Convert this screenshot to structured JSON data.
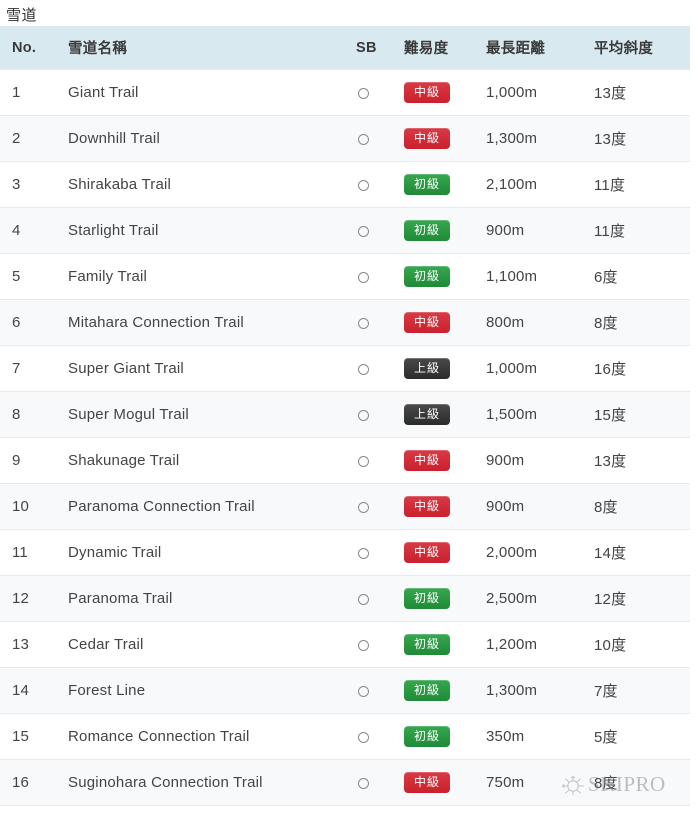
{
  "page": {
    "title": "雪道"
  },
  "table": {
    "columns": [
      {
        "key": "no",
        "label": "No."
      },
      {
        "key": "name",
        "label": "雪道名稱"
      },
      {
        "key": "sb",
        "label": "SB"
      },
      {
        "key": "diff",
        "label": "難易度"
      },
      {
        "key": "dist",
        "label": "最長距離"
      },
      {
        "key": "slope",
        "label": "平均斜度"
      }
    ],
    "sb_symbol": "○",
    "rows": [
      {
        "no": "1",
        "name": "Giant Trail",
        "sb": "○",
        "diff": "中級",
        "diff_level": "intermediate",
        "dist": "1,000m",
        "slope": "13度"
      },
      {
        "no": "2",
        "name": "Downhill Trail",
        "sb": "○",
        "diff": "中級",
        "diff_level": "intermediate",
        "dist": "1,300m",
        "slope": "13度"
      },
      {
        "no": "3",
        "name": "Shirakaba Trail",
        "sb": "○",
        "diff": "初級",
        "diff_level": "beginner",
        "dist": "2,100m",
        "slope": "11度"
      },
      {
        "no": "4",
        "name": "Starlight Trail",
        "sb": "○",
        "diff": "初級",
        "diff_level": "beginner",
        "dist": "900m",
        "slope": "11度"
      },
      {
        "no": "5",
        "name": "Family Trail",
        "sb": "○",
        "diff": "初級",
        "diff_level": "beginner",
        "dist": "1,100m",
        "slope": "6度"
      },
      {
        "no": "6",
        "name": "Mitahara Connection Trail",
        "sb": "○",
        "diff": "中級",
        "diff_level": "intermediate",
        "dist": "800m",
        "slope": "8度"
      },
      {
        "no": "7",
        "name": "Super Giant Trail",
        "sb": "○",
        "diff": "上級",
        "diff_level": "advanced",
        "dist": "1,000m",
        "slope": "16度"
      },
      {
        "no": "8",
        "name": "Super Mogul Trail",
        "sb": "○",
        "diff": "上級",
        "diff_level": "advanced",
        "dist": "1,500m",
        "slope": "15度"
      },
      {
        "no": "9",
        "name": "Shakunage Trail",
        "sb": "○",
        "diff": "中級",
        "diff_level": "intermediate",
        "dist": "900m",
        "slope": "13度"
      },
      {
        "no": "10",
        "name": "Paranoma Connection Trail",
        "sb": "○",
        "diff": "中級",
        "diff_level": "intermediate",
        "dist": "900m",
        "slope": "8度"
      },
      {
        "no": "11",
        "name": "Dynamic Trail",
        "sb": "○",
        "diff": "中級",
        "diff_level": "intermediate",
        "dist": "2,000m",
        "slope": "14度"
      },
      {
        "no": "12",
        "name": "Paranoma Trail",
        "sb": "○",
        "diff": "初級",
        "diff_level": "beginner",
        "dist": "2,500m",
        "slope": "12度"
      },
      {
        "no": "13",
        "name": "Cedar Trail",
        "sb": "○",
        "diff": "初級",
        "diff_level": "beginner",
        "dist": "1,200m",
        "slope": "10度"
      },
      {
        "no": "14",
        "name": "Forest Line",
        "sb": "○",
        "diff": "初級",
        "diff_level": "beginner",
        "dist": "1,300m",
        "slope": "7度"
      },
      {
        "no": "15",
        "name": "Romance Connection Trail",
        "sb": "○",
        "diff": "初級",
        "diff_level": "beginner",
        "dist": "350m",
        "slope": "5度"
      },
      {
        "no": "16",
        "name": "Suginohara Connection Trail",
        "sb": "○",
        "diff": "中級",
        "diff_level": "intermediate",
        "dist": "750m",
        "slope": "8度"
      }
    ]
  },
  "watermark": {
    "text": "SKIPRO",
    "icon": "snowflake-icon"
  },
  "colors": {
    "header_bg": "#d9e9f0",
    "row_alt_bg": "#f8f9fa",
    "badge_intermediate": "#c9202c",
    "badge_beginner": "#1f8a37",
    "badge_advanced": "#2b2b2b",
    "text": "#444444"
  }
}
